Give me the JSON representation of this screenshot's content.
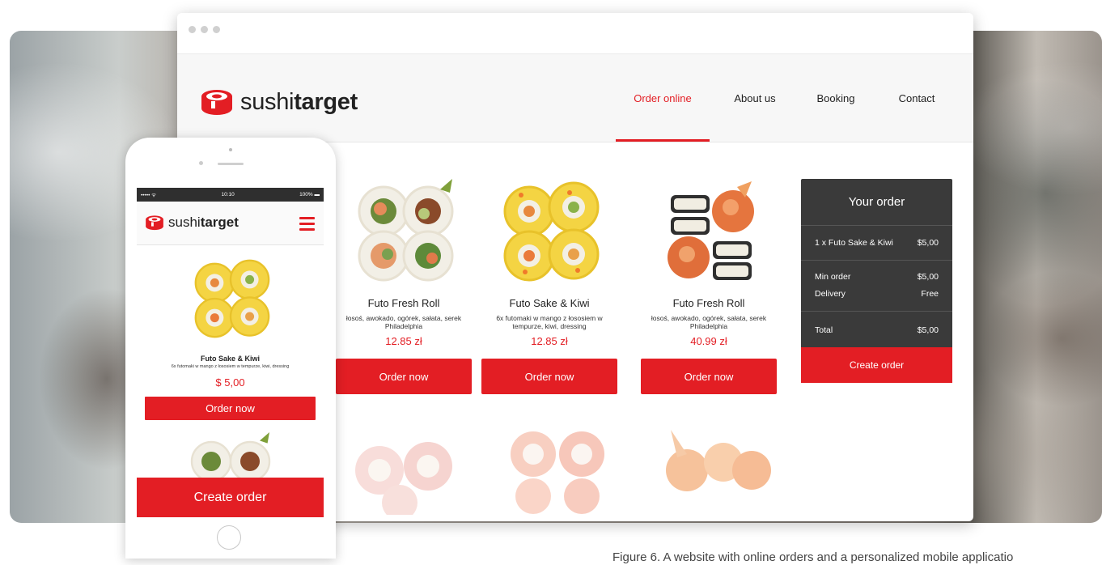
{
  "colors": {
    "accent": "#e31e24",
    "dark_panel": "#3a3a3a"
  },
  "brand": {
    "name_light": "sushi",
    "name_bold": "target"
  },
  "nav": [
    {
      "label": "Order online",
      "active": true
    },
    {
      "label": "About us",
      "active": false
    },
    {
      "label": "Booking",
      "active": false
    },
    {
      "label": "Contact",
      "active": false
    }
  ],
  "products": [
    {
      "name": "Futo Fresh Roll",
      "desc": "łosoś, awokado, ogórek, sałata, serek Philadelphia",
      "price": "12.85 zł",
      "button": "Order now"
    },
    {
      "name": "Futo Sake & Kiwi",
      "desc": "6x futomaki w mango z łososiem w tempurze, kiwi, dressing",
      "price": "12.85 zł",
      "button": "Order now"
    },
    {
      "name": "Futo Fresh Roll",
      "desc": "łosoś, awokado, ogórek, sałata, serek Philadelphia",
      "price": "40.99 zł",
      "button": "Order now"
    }
  ],
  "order": {
    "title": "Your order",
    "item_label": "1 x Futo Sake & Kiwi",
    "item_price": "$5,00",
    "min_label": "Min order",
    "min_value": "$5,00",
    "delivery_label": "Delivery",
    "delivery_value": "Free",
    "total_label": "Total",
    "total_value": "$5,00",
    "button": "Create order"
  },
  "mobile": {
    "status_left": "••••• ᯤ",
    "status_time": "10:10",
    "status_right": "100% ▬",
    "product_name": "Futo Sake & Kiwi",
    "product_desc": "6x futomaki w mango z łososiem w tempurze, kiwi, dressing",
    "product_price": "$ 5,00",
    "order_button": "Order now",
    "create_button": "Create order"
  },
  "caption": "Figure 6. A website with online orders and a personalized mobile applicatio"
}
